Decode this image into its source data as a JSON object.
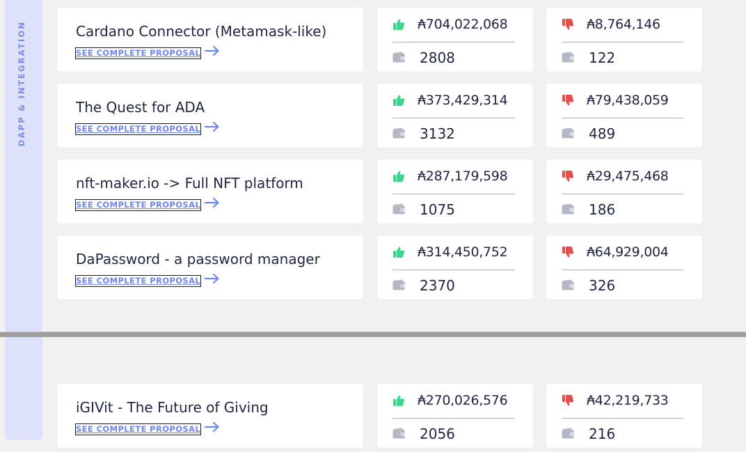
{
  "category": {
    "label": "DAPP & INTEGRATION"
  },
  "link_label": "SEE COMPLETE PROPOSAL",
  "colors": {
    "yes": "#3dd68c",
    "no": "#ea4b4b",
    "accent": "#6f86ea",
    "tab_bg": "#dde2fa"
  },
  "proposals": [
    {
      "title": "Cardano Connector (Metamask-like)",
      "yes_ada": "₳704,022,068",
      "yes_wallets": "2808",
      "no_ada": "₳8,764,146",
      "no_wallets": "122"
    },
    {
      "title": "The Quest for ADA",
      "yes_ada": "₳373,429,314",
      "yes_wallets": "3132",
      "no_ada": "₳79,438,059",
      "no_wallets": "489"
    },
    {
      "title": "nft-maker.io -> Full NFT platform",
      "yes_ada": "₳287,179,598",
      "yes_wallets": "1075",
      "no_ada": "₳29,475,468",
      "no_wallets": "186"
    },
    {
      "title": "DaPassword - a password manager",
      "yes_ada": "₳314,450,752",
      "yes_wallets": "2370",
      "no_ada": "₳64,929,004",
      "no_wallets": "326"
    },
    {
      "title": "iGIVit - The Future of Giving",
      "yes_ada": "₳270,026,576",
      "yes_wallets": "2056",
      "no_ada": "₳42,219,733",
      "no_wallets": "216"
    }
  ]
}
